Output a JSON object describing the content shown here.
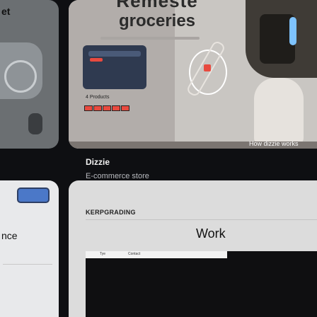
{
  "left_top": {
    "label": "et"
  },
  "left_bottom": {
    "label": "nce"
  },
  "hero": {
    "brand": "Remeste",
    "title": "groceries",
    "laptop_meta": "4 Products",
    "footer": "How dizzie works"
  },
  "card": {
    "title": "Dizzie",
    "subtitle": "E-commerce store"
  },
  "bottom_card": {
    "brand": "KERPGRADING",
    "work": "Work",
    "tab1": "Tye",
    "tab2": "Contact"
  }
}
